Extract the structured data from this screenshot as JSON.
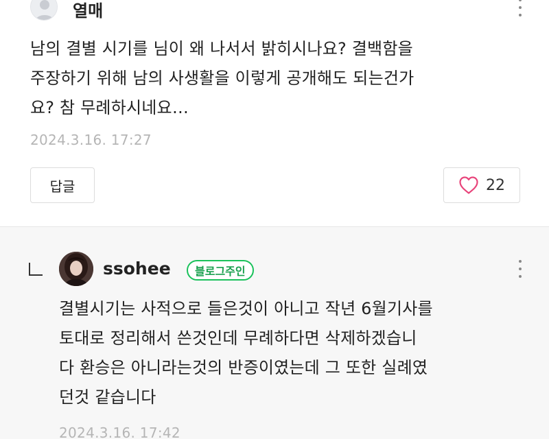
{
  "comment": {
    "author": "열매",
    "avatar_icon": "default-profile-icon",
    "body_lines": [
      "남의 결별 시기를 님이 왜 나서서 밝히시나요? 결백함을",
      "주장하기 위해 남의 사생활을 이렇게 공개해도 되는건가",
      "요? 참 무례하시네요…"
    ],
    "date": "2024.3.16. 17:27",
    "reply_label": "답글",
    "like_count": "22",
    "like_icon": "heart-outline-icon",
    "like_color": "#e8437a",
    "more_icon": "more-vertical-icon"
  },
  "reply": {
    "author": "ssohee",
    "badge": "블로그주인",
    "badge_color": "#19c15a",
    "reply_arrow_icon": "reply-corner-icon",
    "body_lines": [
      "결별시기는 사적으로 들은것이 아니고 작년 6월기사를",
      "토대로 정리해서 쓴것인데 무례하다면 삭제하겠습니",
      "다 환승은 아니라는것의 반증이였는데 그 또한 실례였",
      "던것 같습니다"
    ],
    "date": "2024.3.16. 17:42",
    "more_icon": "more-vertical-icon"
  }
}
